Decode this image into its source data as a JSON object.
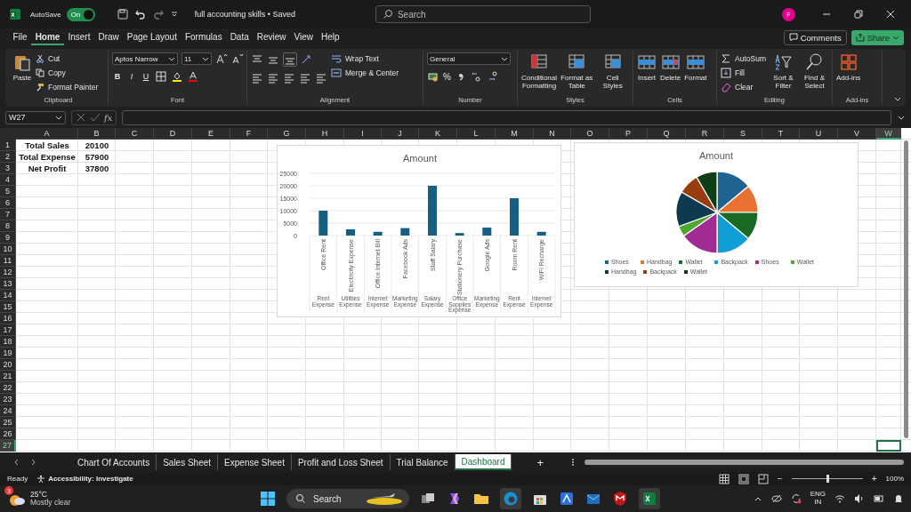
{
  "titlebar": {
    "autosave": {
      "label": "AutoSave",
      "toggle": "On",
      "on": true
    },
    "filename": "full accounting skills • Saved",
    "search": {
      "placeholder": "Search"
    },
    "avatar": "F"
  },
  "menu": {
    "tabs": [
      {
        "label": "File",
        "selected": false
      },
      {
        "label": "Home",
        "selected": true
      },
      {
        "label": "Insert",
        "selected": false
      },
      {
        "label": "Draw",
        "selected": false
      },
      {
        "label": "Page Layout",
        "selected": false
      },
      {
        "label": "Formulas",
        "selected": false
      },
      {
        "label": "Data",
        "selected": false
      },
      {
        "label": "Review",
        "selected": false
      },
      {
        "label": "View",
        "selected": false
      },
      {
        "label": "Help",
        "selected": false
      }
    ],
    "comments": "Comments",
    "share": "Share"
  },
  "ribbon": {
    "clipboard": {
      "label": "Clipboard",
      "paste": "Paste",
      "cut": "Cut",
      "copy": "Copy",
      "format_painter": "Format Painter"
    },
    "font": {
      "label": "Font",
      "font_name": "Aptos Narrow",
      "font_size": "11",
      "bold": "B",
      "italic": "I",
      "underline": "U"
    },
    "alignment": {
      "label": "Alignment",
      "wrap_text": "Wrap Text",
      "merge_center": "Merge & Center"
    },
    "number": {
      "label": "Number",
      "format": "General",
      "percent": "%"
    },
    "styles": {
      "label": "Styles",
      "buttons": [
        "Conditional Formatting",
        "Format as Table",
        "Cell Styles"
      ]
    },
    "cells": {
      "label": "Cells",
      "buttons": [
        "Insert",
        "Delete",
        "Format"
      ]
    },
    "editing": {
      "label": "Editing",
      "autosum": "AutoSum",
      "fill": "Fill",
      "clear": "Clear",
      "buttons": [
        "Sort & Filter",
        "Find & Select"
      ]
    },
    "addins": {
      "label": "Add-ins",
      "button": "Add-ins"
    }
  },
  "formula_bar": {
    "name_box": "W27",
    "fx": "fx"
  },
  "sheet": {
    "columns": [
      {
        "label": "A",
        "selected": false
      },
      {
        "label": "B",
        "selected": false
      },
      {
        "label": "C",
        "selected": false
      },
      {
        "label": "D",
        "selected": false
      },
      {
        "label": "E",
        "selected": false
      },
      {
        "label": "F",
        "selected": false
      },
      {
        "label": "G",
        "selected": false
      },
      {
        "label": "H",
        "selected": false
      },
      {
        "label": "I",
        "selected": false
      },
      {
        "label": "J",
        "selected": false
      },
      {
        "label": "K",
        "selected": false
      },
      {
        "label": "L",
        "selected": false
      },
      {
        "label": "M",
        "selected": false
      },
      {
        "label": "N",
        "selected": false
      },
      {
        "label": "O",
        "selected": false
      },
      {
        "label": "P",
        "selected": false
      },
      {
        "label": "Q",
        "selected": false
      },
      {
        "label": "R",
        "selected": false
      },
      {
        "label": "S",
        "selected": false
      },
      {
        "label": "T",
        "selected": false
      },
      {
        "label": "U",
        "selected": false
      },
      {
        "label": "V",
        "selected": false
      },
      {
        "label": "W",
        "selected": true
      }
    ],
    "rows": [
      {
        "label": "1",
        "selected": false
      },
      {
        "label": "2",
        "selected": false
      },
      {
        "label": "3",
        "selected": false
      },
      {
        "label": "4",
        "selected": false
      },
      {
        "label": "5",
        "selected": false
      },
      {
        "label": "6",
        "selected": false
      },
      {
        "label": "7",
        "selected": false
      },
      {
        "label": "8",
        "selected": false
      },
      {
        "label": "9",
        "selected": false
      },
      {
        "label": "10",
        "selected": false
      },
      {
        "label": "11",
        "selected": false
      },
      {
        "label": "12",
        "selected": false
      },
      {
        "label": "13",
        "selected": false
      },
      {
        "label": "14",
        "selected": false
      },
      {
        "label": "15",
        "selected": false
      },
      {
        "label": "16",
        "selected": false
      },
      {
        "label": "17",
        "selected": false
      },
      {
        "label": "18",
        "selected": false
      },
      {
        "label": "19",
        "selected": false
      },
      {
        "label": "20",
        "selected": false
      },
      {
        "label": "21",
        "selected": false
      },
      {
        "label": "22",
        "selected": false
      },
      {
        "label": "23",
        "selected": false
      },
      {
        "label": "24",
        "selected": false
      },
      {
        "label": "25",
        "selected": false
      },
      {
        "label": "26",
        "selected": false
      },
      {
        "label": "27",
        "selected": true
      }
    ],
    "cells": [
      [
        "Total Sales",
        "20100"
      ],
      [
        "Total Expense",
        "57900"
      ],
      [
        "Net Profit",
        "37800"
      ]
    ],
    "bar_chart": {
      "chart_data": {
        "type": "bar",
        "title": "Amount",
        "grid": true,
        "categories": [
          "Office Rent",
          "Electricity Expense",
          "Office Internet Bill",
          "Facebook Ads",
          "Staff Salary",
          "Stationery Purchase",
          "Google Ads",
          "Room Rent",
          "WiFi Recharge"
        ],
        "values": [
          10000,
          2500,
          1500,
          3000,
          20000,
          1000,
          3200,
          15000,
          1500
        ],
        "ylim": [
          0,
          25000
        ],
        "yticks": [
          0,
          5000,
          10000,
          15000,
          20000,
          25000
        ]
      },
      "category_groups": [
        "Rent Expense",
        "Utilities Expense",
        "Internet Expense",
        "Marketing Expense",
        "Salary Expense",
        "Office Supplies Expense",
        "Marketing Expense",
        "Rent Expense",
        "Internet Expense"
      ]
    },
    "pie_chart": {
      "title": "Amount",
      "legend": [
        {
          "label": "Shoes",
          "color": "#1f6391"
        },
        {
          "label": "Handbag",
          "color": "#e97132"
        },
        {
          "label": "Wallet",
          "color": "#196b24"
        },
        {
          "label": "Backpack",
          "color": "#0f9ed5"
        },
        {
          "label": "Shoes",
          "color": "#a02b93"
        },
        {
          "label": "Wallet",
          "color": "#4ea72e"
        },
        {
          "label": "Handbag",
          "color": "#0e3a4f"
        },
        {
          "label": "Backpack",
          "color": "#983d10"
        },
        {
          "label": "Wallet",
          "color": "#0e3d16"
        }
      ]
    }
  },
  "sheet_tabs": {
    "tabs": [
      {
        "label": "Chart Of Accounts",
        "selected": false
      },
      {
        "label": "Sales Sheet",
        "selected": false
      },
      {
        "label": "Expense Sheet",
        "selected": false
      },
      {
        "label": "Profit and Loss Sheet",
        "selected": false
      },
      {
        "label": "Trial Balance",
        "selected": false
      },
      {
        "label": "Dashboard",
        "selected": true
      }
    ],
    "add": "+"
  },
  "status_bar": {
    "ready": "Ready",
    "accessibility": "Accessibility: Investigate",
    "zoom_minus": "−",
    "zoom_plus": "+",
    "zoom": {
      "level": 0.5
    },
    "zoom_reading": "100%"
  },
  "taskbar": {
    "weather": {
      "badge": "3",
      "temperature": "25°C",
      "condition": "Mostly clear"
    },
    "search": "Search",
    "language": "ENG",
    "region": "IN"
  }
}
